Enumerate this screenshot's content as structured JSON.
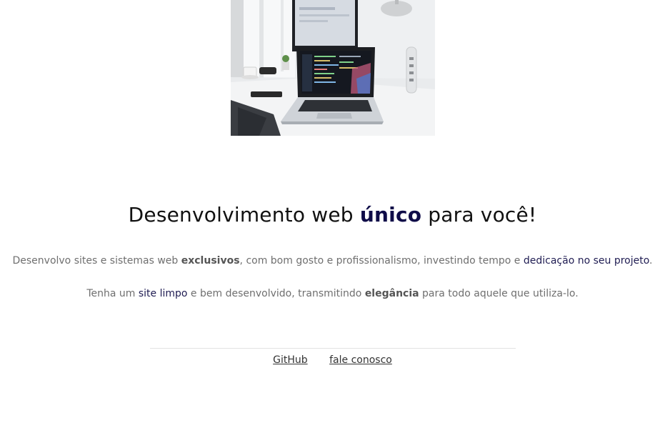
{
  "hero": {
    "image_label": "laptop-on-desk-photo"
  },
  "headline": {
    "pre": "Desenvolvimento web ",
    "highlight": "único",
    "post": " para você!"
  },
  "intro": {
    "p1_a": "Desenvolvo sites e sistemas web ",
    "p1_b": "exclusivos",
    "p1_c": ", com bom gosto e profissionalismo, investindo tempo e ",
    "p1_d": "dedicação no seu projeto",
    "p1_e": ".",
    "p2_a": "Tenha um ",
    "p2_b": "site limpo",
    "p2_c": " e bem desenvolvido, transmitindo ",
    "p2_d": "elegância",
    "p2_e": " para todo aquele que utiliza-lo."
  },
  "footer": {
    "links": [
      "GitHub",
      "fale conosco"
    ]
  },
  "colors": {
    "accent": "#0f0c48",
    "body_text": "#6f6f6f"
  }
}
